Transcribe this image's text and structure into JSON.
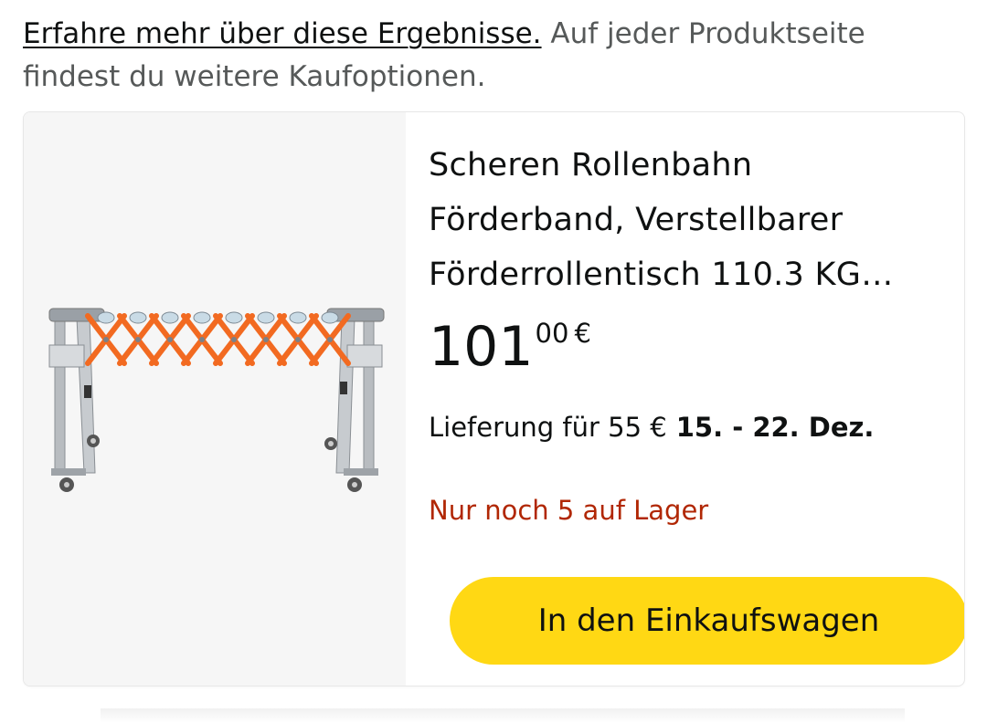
{
  "intro": {
    "link_text": "Erfahre mehr über diese Ergebnisse.",
    "rest_text": " Auf jeder Produktseite findest du weitere Kaufoptionen."
  },
  "product": {
    "image_icon": "roller-conveyor-product-image",
    "title_line1": "Scheren Rollenbahn",
    "title_line2": "Förderband, Verstellbarer",
    "title_line3": "Förderrollentisch 110.3 KG…",
    "price": {
      "whole": "101",
      "fraction": "00",
      "currency": "€"
    },
    "delivery": {
      "prefix": "Lieferung für 55 €",
      "dates": "15. - 22. Dez."
    },
    "stock": "Nur noch 5 auf Lager",
    "add_to_cart_label": "In den Einkaufswagen"
  },
  "colors": {
    "button_yellow": "#ffd814",
    "stock_red": "#b12704",
    "text_dark": "#0f1111",
    "text_gray": "#565959",
    "image_background": "#f6f6f6",
    "scissor_orange": "#f26a21"
  }
}
